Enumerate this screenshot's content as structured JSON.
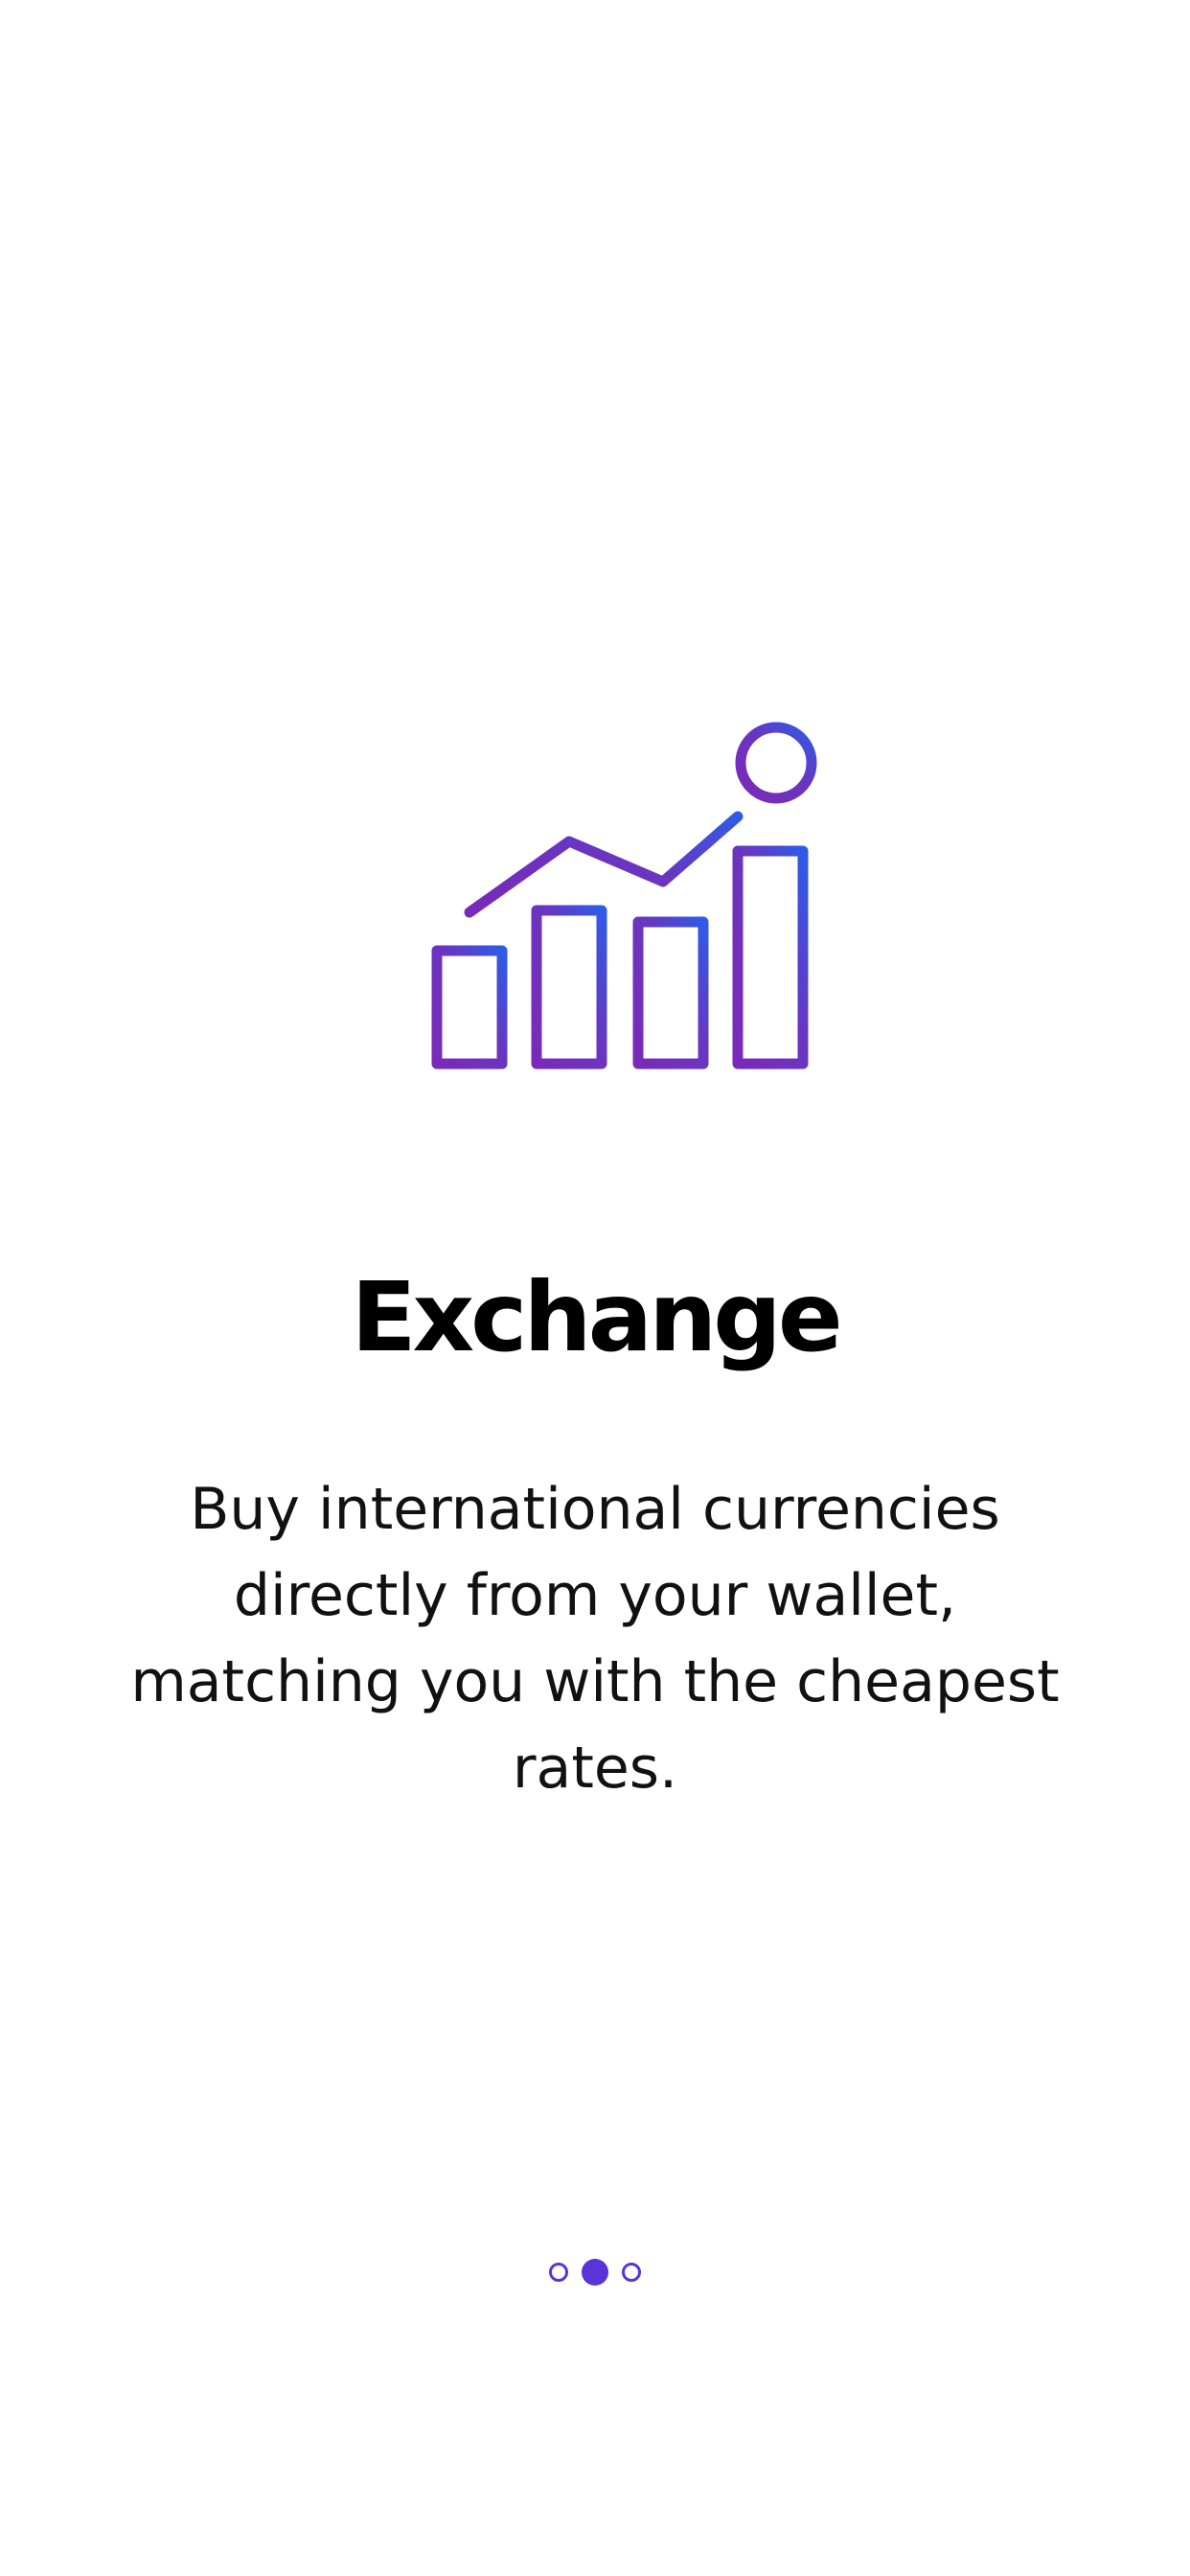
{
  "onboarding": {
    "illustration": "chart-growth-icon",
    "title": "Exchange",
    "description": "Buy international currencies directly from your wallet, matching you with the cheapest rates.",
    "pager": {
      "pages": 3,
      "current": 2
    }
  },
  "colors": {
    "background": "#ffffff",
    "gradient_start": "#7a2ab8",
    "gradient_end": "#2f5be6",
    "pager_accent": "#5a34d6",
    "title": "#000000",
    "text": "#111111"
  }
}
